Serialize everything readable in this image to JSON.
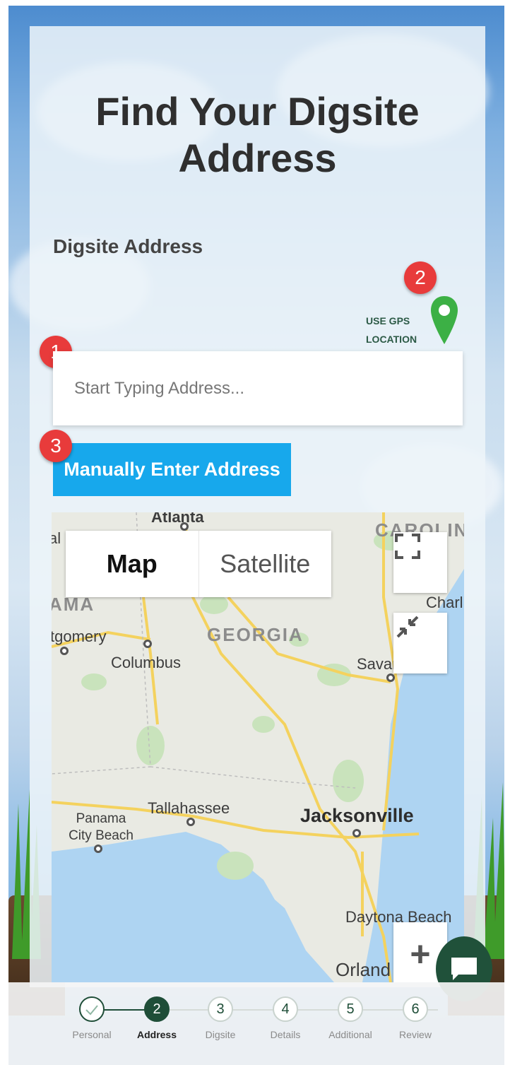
{
  "page": {
    "title": "Find Your Digsite Address",
    "field_label": "Digsite Address",
    "gps": {
      "label": "USE GPS LOCATION"
    },
    "address_input": {
      "placeholder": "Start Typing Address...",
      "value": ""
    },
    "manual_button": "Manually Enter Address",
    "annotations": [
      "1",
      "2",
      "3"
    ]
  },
  "map": {
    "type_control": {
      "map_label": "Map",
      "satellite_label": "Satellite",
      "selected": "Map"
    },
    "controls": [
      "fullscreen-icon",
      "collapse-icon",
      "zoom-in-icon"
    ],
    "zoom_in_label": "+",
    "labels": {
      "states": [
        "GEORGIA",
        "AMA",
        "CAROLIN"
      ],
      "cities": [
        "Atlanta",
        "Columbus",
        "tgomery",
        "Tallahassee",
        "Panama City Beach",
        "Jacksonville",
        "Savar",
        "Charl",
        "Daytona Beach",
        "Orland",
        "al"
      ]
    }
  },
  "stepper": {
    "steps": [
      {
        "number": "",
        "label": "Personal",
        "state": "done"
      },
      {
        "number": "2",
        "label": "Address",
        "state": "current"
      },
      {
        "number": "3",
        "label": "Digsite",
        "state": "upcoming"
      },
      {
        "number": "4",
        "label": "Details",
        "state": "upcoming"
      },
      {
        "number": "5",
        "label": "Additional",
        "state": "upcoming"
      },
      {
        "number": "6",
        "label": "Review",
        "state": "upcoming"
      }
    ]
  },
  "colors": {
    "accent_green": "#1f4e38",
    "button_blue": "#17a8ec",
    "badge_red": "#e83b3b",
    "pin_green": "#3cb045"
  }
}
